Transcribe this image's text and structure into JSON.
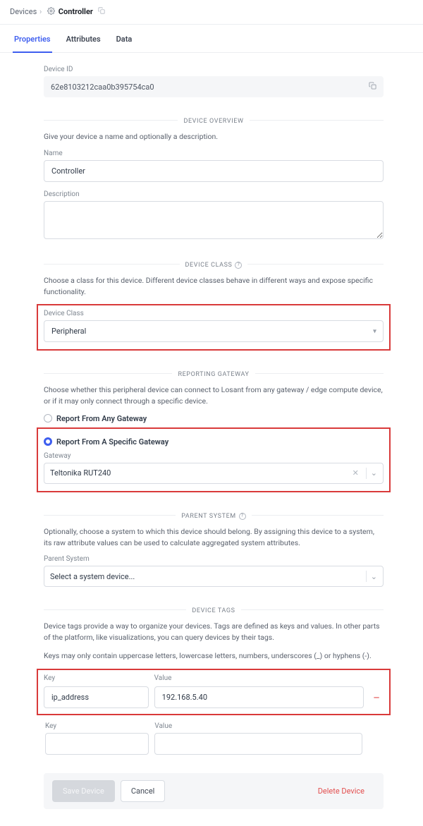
{
  "breadcrumb": {
    "parent": "Devices",
    "title": "Controller"
  },
  "tabs": [
    "Properties",
    "Attributes",
    "Data"
  ],
  "device_id": {
    "label": "Device ID",
    "value": "62e8103212caa0b395754ca0"
  },
  "overview": {
    "section_title": "DEVICE OVERVIEW",
    "desc": "Give your device a name and optionally a description.",
    "name_label": "Name",
    "name_value": "Controller",
    "description_label": "Description",
    "description_value": ""
  },
  "device_class": {
    "section_title": "DEVICE CLASS",
    "desc": "Choose a class for this device. Different device classes behave in different ways and expose specific functionality.",
    "label": "Device Class",
    "value": "Peripheral"
  },
  "gateway": {
    "section_title": "REPORTING GATEWAY",
    "desc": "Choose whether this peripheral device can connect to Losant from any gateway / edge compute device, or if it may only connect through a specific device.",
    "opt_any": "Report From Any Gateway",
    "opt_specific": "Report From A Specific Gateway",
    "gateway_label": "Gateway",
    "gateway_value": "Teltonika RUT240"
  },
  "parent_system": {
    "section_title": "PARENT SYSTEM",
    "desc": "Optionally, choose a system to which this device should belong. By assigning this device to a system, its raw attribute values can be used to calculate aggregated system attributes.",
    "label": "Parent System",
    "placeholder": "Select a system device..."
  },
  "tags": {
    "section_title": "DEVICE TAGS",
    "desc1": "Device tags provide a way to organize your devices. Tags are defined as keys and values. In other parts of the platform, like visualizations, you can query devices by their tags.",
    "desc2": "Keys may only contain uppercase letters, lowercase letters, numbers, underscores (_) or hyphens (-).",
    "key_label": "Key",
    "value_label": "Value",
    "rows": [
      {
        "key": "ip_address",
        "value": "192.168.5.40"
      }
    ]
  },
  "footer": {
    "save": "Save Device",
    "cancel": "Cancel",
    "delete": "Delete Device"
  }
}
